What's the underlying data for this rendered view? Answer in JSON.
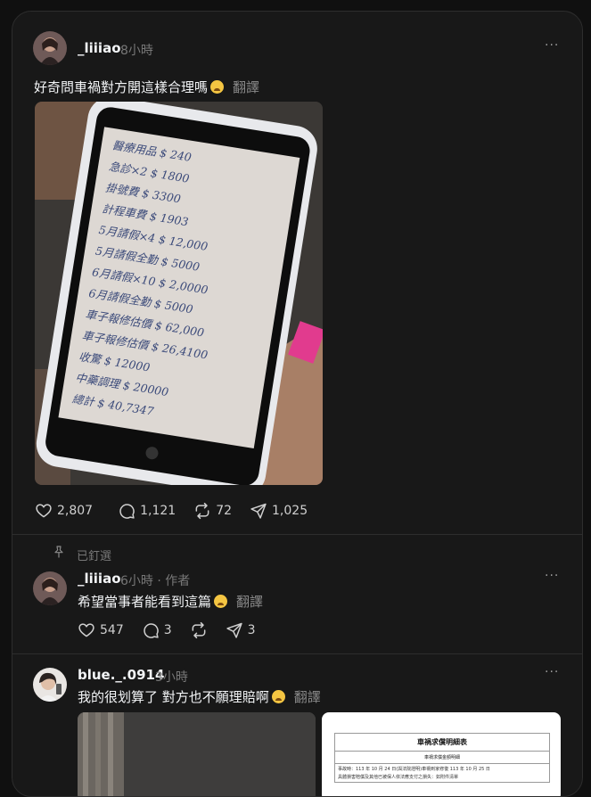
{
  "post": {
    "username": "_liiiao",
    "time": "8小時",
    "text": "好奇問車禍對方開這樣合理嗎",
    "translate": "翻譯",
    "photo_lines": [
      "醫療用品 $ 240",
      "急診×2 $ 1800",
      "掛號費 $ 3300",
      "計程車費 $ 1903",
      "5月請假×4 $ 12,000",
      "5月請假全勤 $ 5000",
      "6月請假×10 $ 2,0000",
      "6月請假全勤 $ 5000",
      "車子報修估價 $ 62,000",
      "車子報修估價 $ 26,4100",
      "收驚 $ 12000",
      "中藥調理 $ 20000",
      "總計 $ 40,7347"
    ],
    "likes": "2,807",
    "comments": "1,121",
    "reposts": "72",
    "shares": "1,025"
  },
  "pinned": {
    "label": "已釘選"
  },
  "reply1": {
    "username": "_liiiao",
    "time": "6小時",
    "dot": "·",
    "author_tag": "作者",
    "text": "希望當事者能看到這篇",
    "translate": "翻譯",
    "likes": "547",
    "comments": "3",
    "shares": "3"
  },
  "reply2": {
    "username": "blue._.0914",
    "time": "3小時",
    "text": "我的很划算了 對方也不願理賠啊",
    "translate": "翻譯",
    "doc_title": "車禍求償明細表",
    "doc_subtitle": "車禍求償金額明細",
    "doc_line1": "事故時：113 年 10 月 24 日(與法院證明)車禍到家修復 113 年 10 月 25 日",
    "doc_line2": "具體損害賠償及其他已被保人依法應支付之損失：如附件清單"
  }
}
